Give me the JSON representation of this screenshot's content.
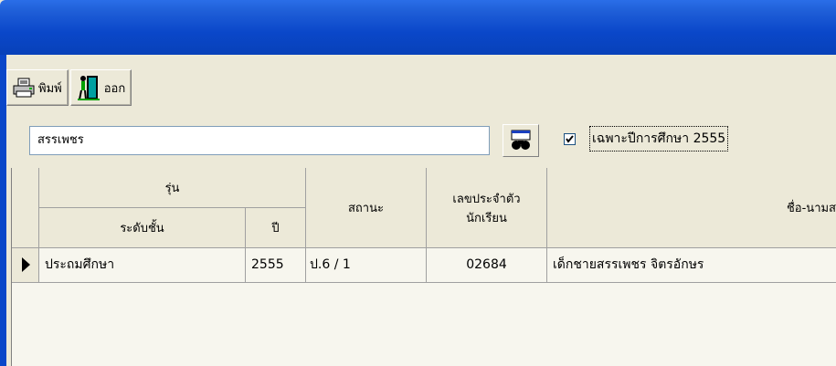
{
  "toolbar": {
    "print_label": "พิมพ์",
    "exit_label": "ออก"
  },
  "search": {
    "value": "สรรเพชร"
  },
  "filter": {
    "label": "เฉพาะปีการศึกษา 2555",
    "checked": true
  },
  "table": {
    "group_header": "รุ่น",
    "headers": {
      "level": "ระดับชั้น",
      "year": "ปี",
      "status": "สถานะ",
      "student_id": "เลขประจำตัว นักเรียน",
      "name": "ชื่อ-นามส"
    },
    "rows": [
      {
        "level": "ประถมศึกษา",
        "year": "2555",
        "status": "ป.6 / 1",
        "student_id": "02684",
        "name": "เด็กชายสรรเพชร จิตรอักษร"
      }
    ]
  }
}
